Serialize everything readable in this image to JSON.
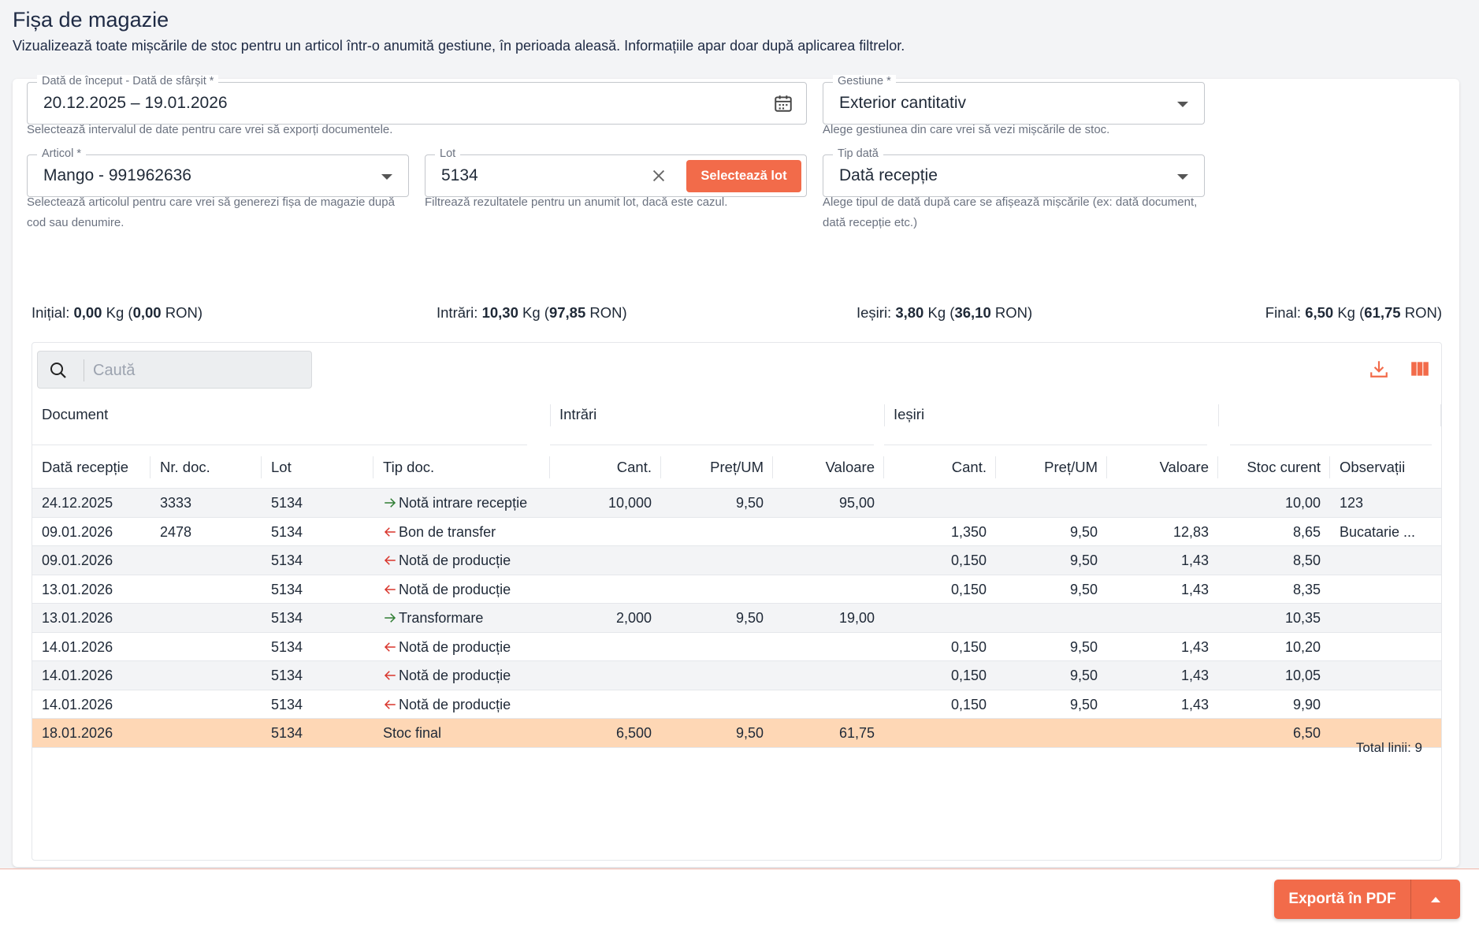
{
  "page": {
    "title": "Fișa de magazie",
    "subtitle": "Vizualizează toate mișcările de stoc pentru un articol într-o anumită gestiune, în perioada aleasă. Informațiile apar doar după aplicarea filtrelor."
  },
  "filters": {
    "date_range": {
      "label": "Dată de început - Dată de sfârșit *",
      "value": "20.12.2025 – 19.01.2026",
      "helper": "Selectează intervalul de date pentru care vrei să exporți documentele."
    },
    "gestiune": {
      "label": "Gestiune *",
      "value": "Exterior cantitativ",
      "helper": "Alege gestiunea din care vrei să vezi mișcările de stoc."
    },
    "articol": {
      "label": "Articol *",
      "value": "Mango - 991962636",
      "helper": "Selectează articolul pentru care vrei să generezi fișa de magazie după cod sau denumire."
    },
    "lot": {
      "label": "Lot",
      "value": "5134",
      "button": "Selectează lot",
      "helper": "Filtrează rezultatele pentru un anumit lot, dacă este cazul."
    },
    "tip_data": {
      "label": "Tip dată",
      "value": "Dată recepție",
      "helper": "Alege tipul de dată după care se afișează mișcările (ex: dată document, dată recepție etc.)"
    }
  },
  "summary": {
    "initial": {
      "label": "Inițial: ",
      "qty": "0,00",
      "unit": " Kg (",
      "value": "0,00",
      "currency": " RON)"
    },
    "intrari": {
      "label": "Intrări: ",
      "qty": "10,30",
      "unit": " Kg (",
      "value": "97,85",
      "currency": " RON)"
    },
    "iesiri": {
      "label": "Ieșiri: ",
      "qty": "3,80",
      "unit": " Kg (",
      "value": "36,10",
      "currency": " RON)"
    },
    "final": {
      "label": "Final: ",
      "qty": "6,50",
      "unit": " Kg (",
      "value": "61,75",
      "currency": " RON)"
    }
  },
  "table": {
    "search_placeholder": "Caută",
    "groups": {
      "document": "Document",
      "intrari": "Intrări",
      "iesiri": "Ieșiri"
    },
    "columns": [
      "Dată recepție",
      "Nr. doc.",
      "Lot",
      "Tip doc.",
      "Cant.",
      "Preț/UM",
      "Valoare",
      "Cant.",
      "Preț/UM",
      "Valoare",
      "Stoc curent",
      "Observații"
    ],
    "rows": [
      {
        "date": "24.12.2025",
        "nr": "3333",
        "lot": "5134",
        "dir": "in",
        "tip": "Notă intrare recepție",
        "in_cant": "10,000",
        "in_pret": "9,50",
        "in_val": "95,00",
        "out_cant": "",
        "out_pret": "",
        "out_val": "",
        "stoc": "10,00",
        "obs": "123"
      },
      {
        "date": "09.01.2026",
        "nr": "2478",
        "lot": "5134",
        "dir": "out",
        "tip": "Bon de transfer",
        "in_cant": "",
        "in_pret": "",
        "in_val": "",
        "out_cant": "1,350",
        "out_pret": "9,50",
        "out_val": "12,83",
        "stoc": "8,65",
        "obs": "Bucatarie ..."
      },
      {
        "date": "09.01.2026",
        "nr": "",
        "lot": "5134",
        "dir": "out",
        "tip": "Notă de producție",
        "in_cant": "",
        "in_pret": "",
        "in_val": "",
        "out_cant": "0,150",
        "out_pret": "9,50",
        "out_val": "1,43",
        "stoc": "8,50",
        "obs": ""
      },
      {
        "date": "13.01.2026",
        "nr": "",
        "lot": "5134",
        "dir": "out",
        "tip": "Notă de producție",
        "in_cant": "",
        "in_pret": "",
        "in_val": "",
        "out_cant": "0,150",
        "out_pret": "9,50",
        "out_val": "1,43",
        "stoc": "8,35",
        "obs": ""
      },
      {
        "date": "13.01.2026",
        "nr": "",
        "lot": "5134",
        "dir": "in",
        "tip": "Transformare",
        "in_cant": "2,000",
        "in_pret": "9,50",
        "in_val": "19,00",
        "out_cant": "",
        "out_pret": "",
        "out_val": "",
        "stoc": "10,35",
        "obs": ""
      },
      {
        "date": "14.01.2026",
        "nr": "",
        "lot": "5134",
        "dir": "out",
        "tip": "Notă de producție",
        "in_cant": "",
        "in_pret": "",
        "in_val": "",
        "out_cant": "0,150",
        "out_pret": "9,50",
        "out_val": "1,43",
        "stoc": "10,20",
        "obs": ""
      },
      {
        "date": "14.01.2026",
        "nr": "",
        "lot": "5134",
        "dir": "out",
        "tip": "Notă de producție",
        "in_cant": "",
        "in_pret": "",
        "in_val": "",
        "out_cant": "0,150",
        "out_pret": "9,50",
        "out_val": "1,43",
        "stoc": "10,05",
        "obs": ""
      },
      {
        "date": "14.01.2026",
        "nr": "",
        "lot": "5134",
        "dir": "out",
        "tip": "Notă de producție",
        "in_cant": "",
        "in_pret": "",
        "in_val": "",
        "out_cant": "0,150",
        "out_pret": "9,50",
        "out_val": "1,43",
        "stoc": "9,90",
        "obs": ""
      },
      {
        "date": "18.01.2026",
        "nr": "",
        "lot": "5134",
        "dir": "final",
        "tip": "Stoc final",
        "in_cant": "6,500",
        "in_pret": "9,50",
        "in_val": "61,75",
        "out_cant": "",
        "out_pret": "",
        "out_val": "",
        "stoc": "6,50",
        "obs": ""
      }
    ],
    "total": "Total linii: 9"
  },
  "footer": {
    "export_label": "Exportă în PDF"
  },
  "colors": {
    "accent": "#f26b4a",
    "in_arrow": "#2e7d32",
    "out_arrow": "#d9342b",
    "final_row": "#fed7b5"
  },
  "icons": [
    "calendar-icon",
    "chevron-down-icon",
    "close-icon",
    "search-icon",
    "download-icon",
    "columns-icon",
    "arrow-right-icon",
    "arrow-left-icon",
    "caret-up-icon"
  ]
}
